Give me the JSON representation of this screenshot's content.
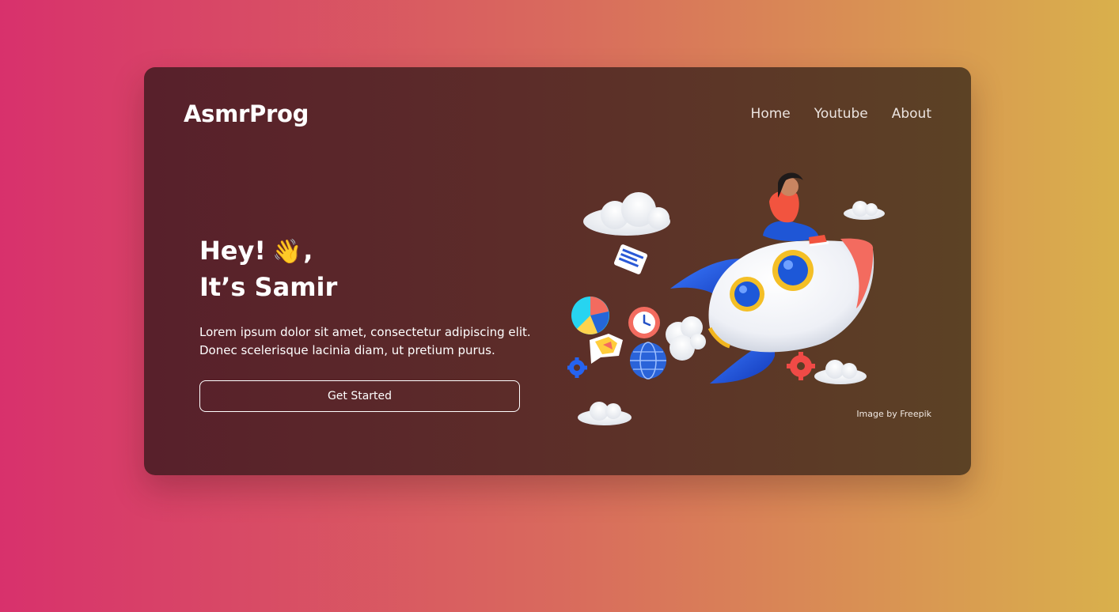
{
  "header": {
    "logo": "AsmrProg",
    "nav": [
      "Home",
      "Youtube",
      "About"
    ]
  },
  "hero": {
    "greeting": "Hey!",
    "emoji": "👋",
    "greeting_suffix": ",",
    "name_line": "It’s Samir",
    "paragraph_line1": "Lorem ipsum dolor sit amet, consectetur adipiscing elit.",
    "paragraph_line2": "Donec scelerisque lacinia diam, ut pretium purus.",
    "cta_label": "Get Started"
  },
  "credit": "Image by Freepik",
  "colors": {
    "bg_left": "#d8316c",
    "bg_right": "#d9b04c",
    "card_left": "#58202b",
    "card_right": "#5c4225",
    "accent_blue": "#1f56d6",
    "accent_red": "#f36b5f"
  },
  "icons": [
    "rocket-illustration",
    "cloud-icon",
    "gear-icon",
    "globe-icon",
    "clock-icon",
    "pie-chart-icon",
    "document-icon",
    "map-icon"
  ]
}
